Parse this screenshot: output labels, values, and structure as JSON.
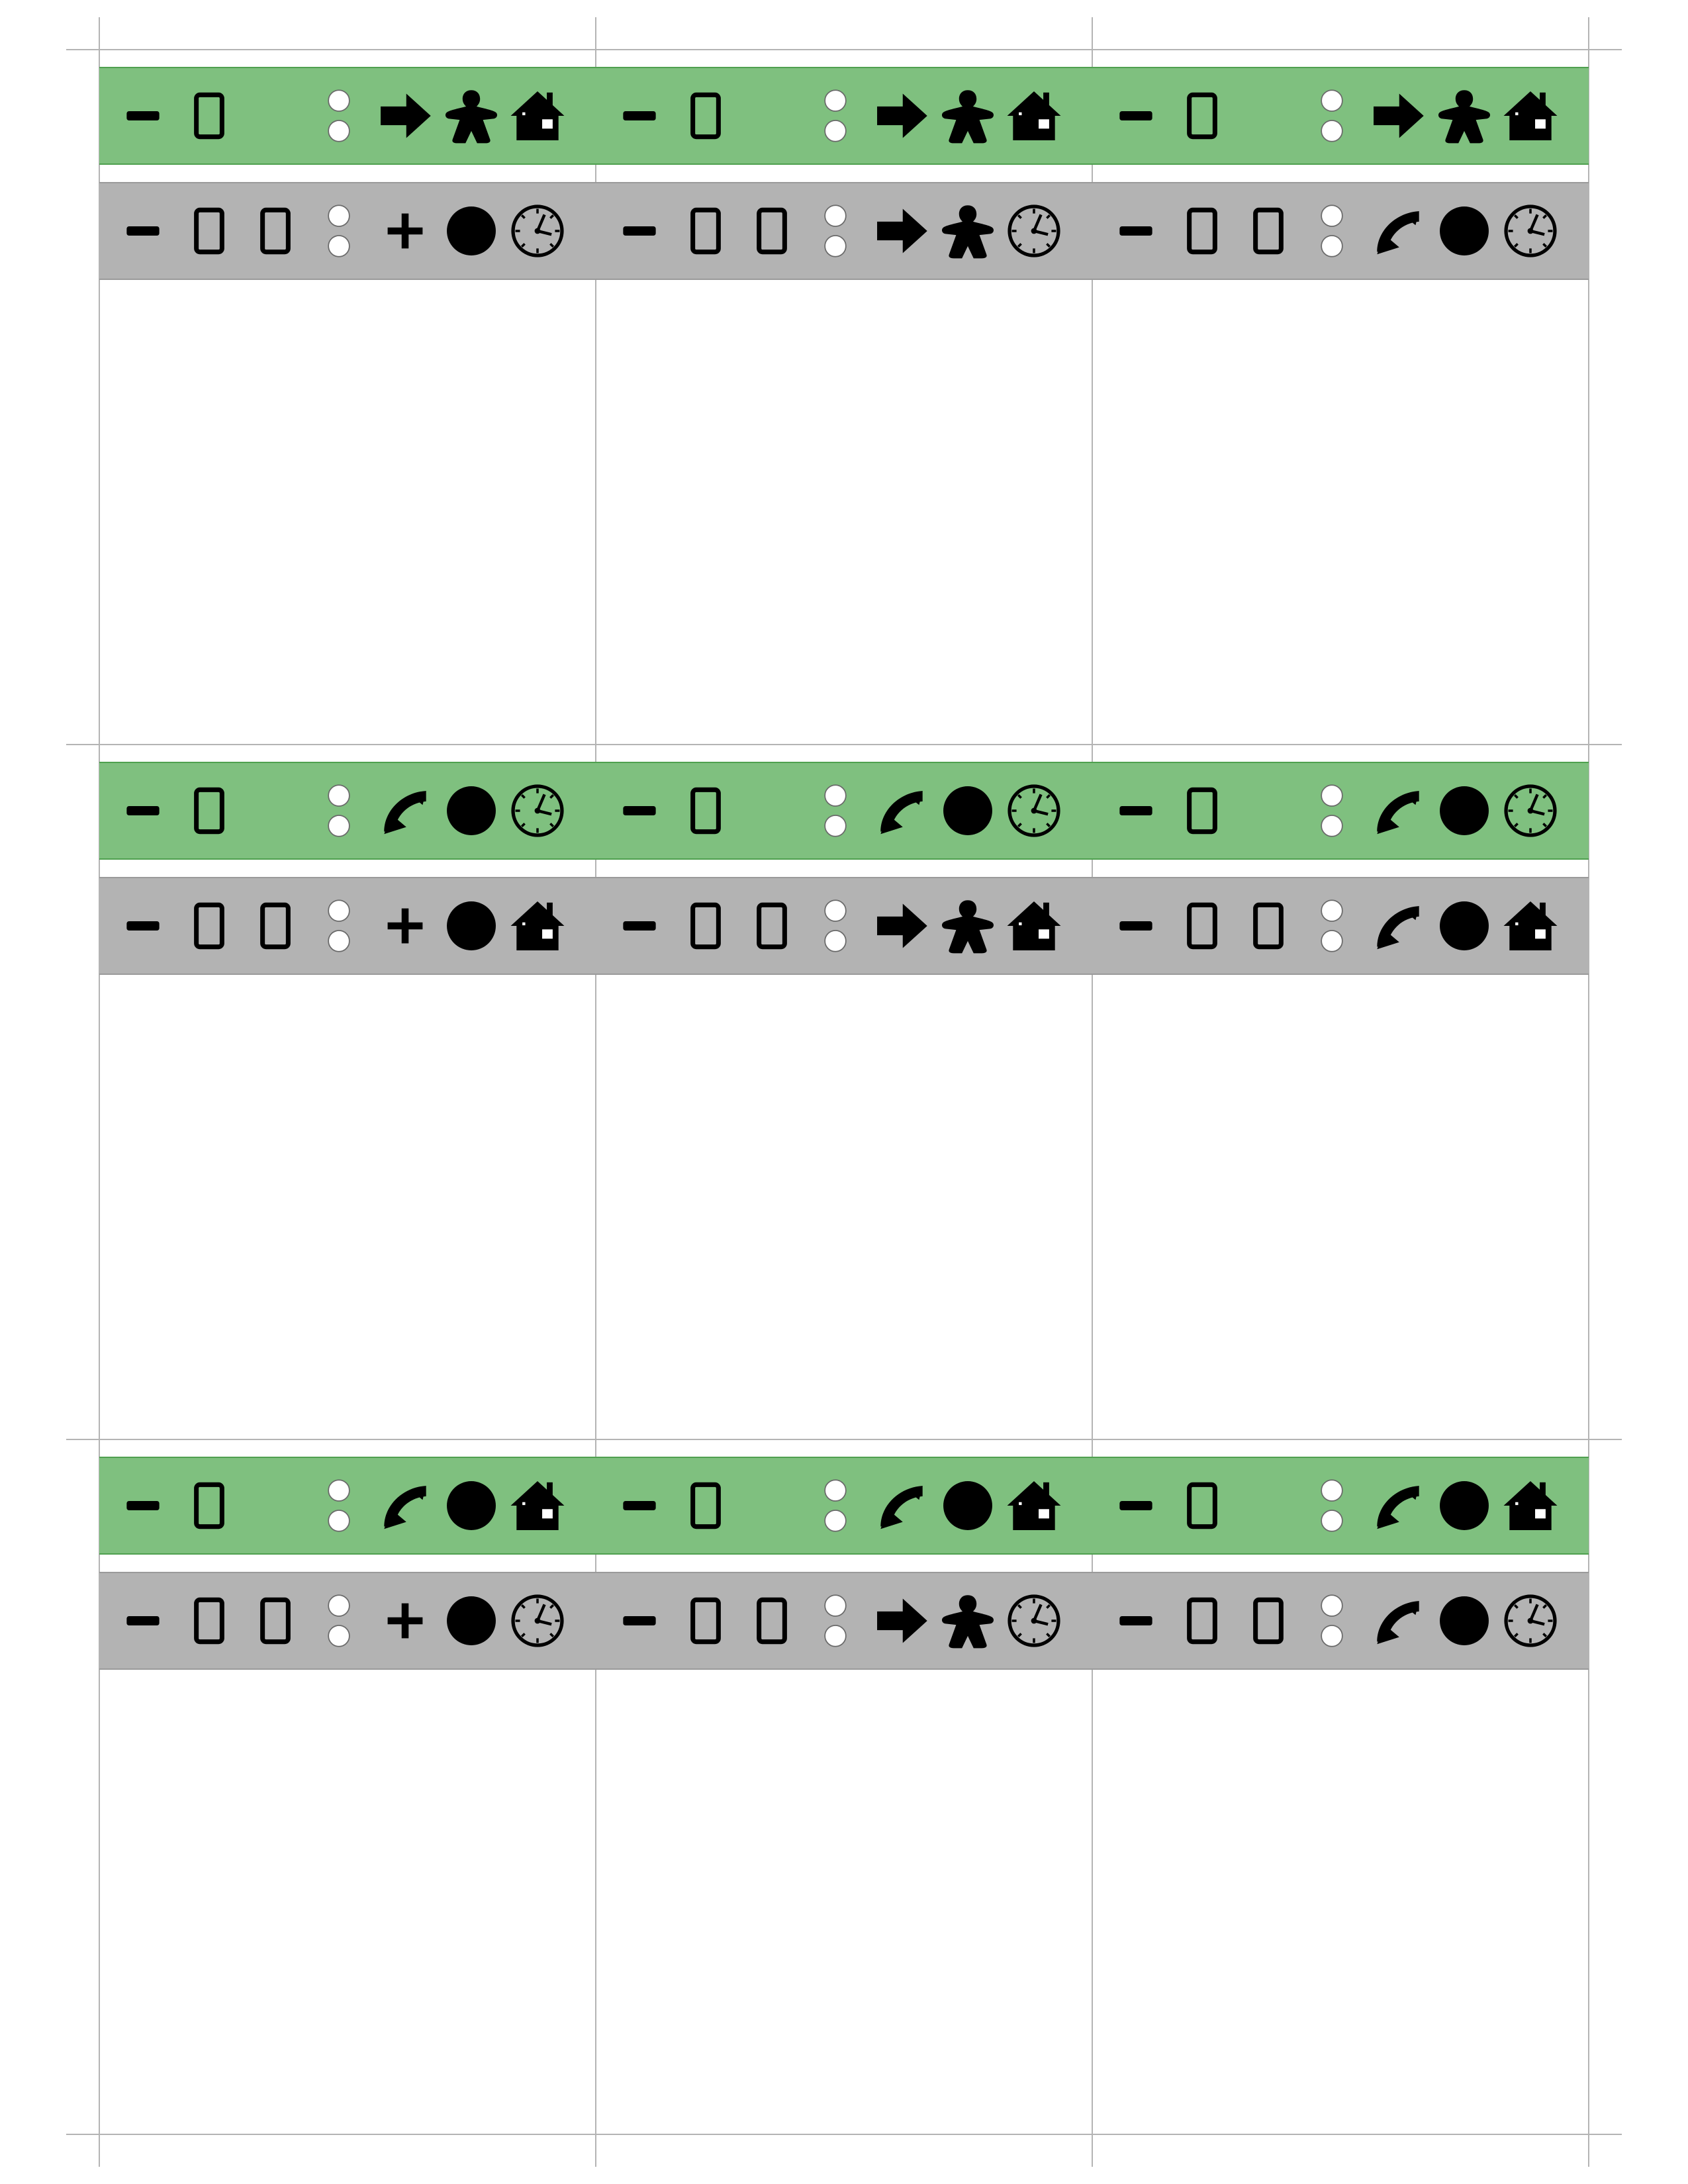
{
  "colors": {
    "primary_band": "#7fc07f",
    "secondary_band": "#b3b3b3",
    "icon": "#000000",
    "pip": "#ffffff",
    "guide": "#b4b4b4"
  },
  "cards": [
    {
      "primary": {
        "cost_icons": [
          "minus-icon",
          "card-icon"
        ],
        "pips": 2,
        "action_icons": [
          "arrow-right-icon",
          "meeple-icon",
          "house-icon"
        ]
      },
      "secondary": {
        "cost_icons": [
          "minus-icon",
          "card-icon",
          "card-icon"
        ],
        "pips": 2,
        "action_icons": [
          "plus-icon",
          "disc-icon",
          "clock-icon"
        ]
      }
    },
    {
      "primary": {
        "cost_icons": [
          "minus-icon",
          "card-icon"
        ],
        "pips": 2,
        "action_icons": [
          "arrow-right-icon",
          "meeple-icon",
          "house-icon"
        ]
      },
      "secondary": {
        "cost_icons": [
          "minus-icon",
          "card-icon",
          "card-icon"
        ],
        "pips": 2,
        "action_icons": [
          "arrow-right-icon",
          "meeple-icon",
          "clock-icon"
        ]
      }
    },
    {
      "primary": {
        "cost_icons": [
          "minus-icon",
          "card-icon"
        ],
        "pips": 2,
        "action_icons": [
          "arrow-right-icon",
          "meeple-icon",
          "house-icon"
        ]
      },
      "secondary": {
        "cost_icons": [
          "minus-icon",
          "card-icon",
          "card-icon"
        ],
        "pips": 2,
        "action_icons": [
          "curved-arrow-icon",
          "disc-icon",
          "clock-icon"
        ]
      }
    },
    {
      "primary": {
        "cost_icons": [
          "minus-icon",
          "card-icon"
        ],
        "pips": 2,
        "action_icons": [
          "curved-arrow-icon",
          "disc-icon",
          "clock-icon"
        ]
      },
      "secondary": {
        "cost_icons": [
          "minus-icon",
          "card-icon",
          "card-icon"
        ],
        "pips": 2,
        "action_icons": [
          "plus-icon",
          "disc-icon",
          "house-icon"
        ]
      }
    },
    {
      "primary": {
        "cost_icons": [
          "minus-icon",
          "card-icon"
        ],
        "pips": 2,
        "action_icons": [
          "curved-arrow-icon",
          "disc-icon",
          "clock-icon"
        ]
      },
      "secondary": {
        "cost_icons": [
          "minus-icon",
          "card-icon",
          "card-icon"
        ],
        "pips": 2,
        "action_icons": [
          "arrow-right-icon",
          "meeple-icon",
          "house-icon"
        ]
      }
    },
    {
      "primary": {
        "cost_icons": [
          "minus-icon",
          "card-icon"
        ],
        "pips": 2,
        "action_icons": [
          "curved-arrow-icon",
          "disc-icon",
          "clock-icon"
        ]
      },
      "secondary": {
        "cost_icons": [
          "minus-icon",
          "card-icon",
          "card-icon"
        ],
        "pips": 2,
        "action_icons": [
          "curved-arrow-icon",
          "disc-icon",
          "house-icon"
        ]
      }
    },
    {
      "primary": {
        "cost_icons": [
          "minus-icon",
          "card-icon"
        ],
        "pips": 2,
        "action_icons": [
          "curved-arrow-icon",
          "disc-icon",
          "house-icon"
        ]
      },
      "secondary": {
        "cost_icons": [
          "minus-icon",
          "card-icon",
          "card-icon"
        ],
        "pips": 2,
        "action_icons": [
          "plus-icon",
          "disc-icon",
          "clock-icon"
        ]
      }
    },
    {
      "primary": {
        "cost_icons": [
          "minus-icon",
          "card-icon"
        ],
        "pips": 2,
        "action_icons": [
          "curved-arrow-icon",
          "disc-icon",
          "house-icon"
        ]
      },
      "secondary": {
        "cost_icons": [
          "minus-icon",
          "card-icon",
          "card-icon"
        ],
        "pips": 2,
        "action_icons": [
          "arrow-right-icon",
          "meeple-icon",
          "clock-icon"
        ]
      }
    },
    {
      "primary": {
        "cost_icons": [
          "minus-icon",
          "card-icon"
        ],
        "pips": 2,
        "action_icons": [
          "curved-arrow-icon",
          "disc-icon",
          "house-icon"
        ]
      },
      "secondary": {
        "cost_icons": [
          "minus-icon",
          "card-icon",
          "card-icon"
        ],
        "pips": 2,
        "action_icons": [
          "curved-arrow-icon",
          "disc-icon",
          "clock-icon"
        ]
      }
    }
  ]
}
